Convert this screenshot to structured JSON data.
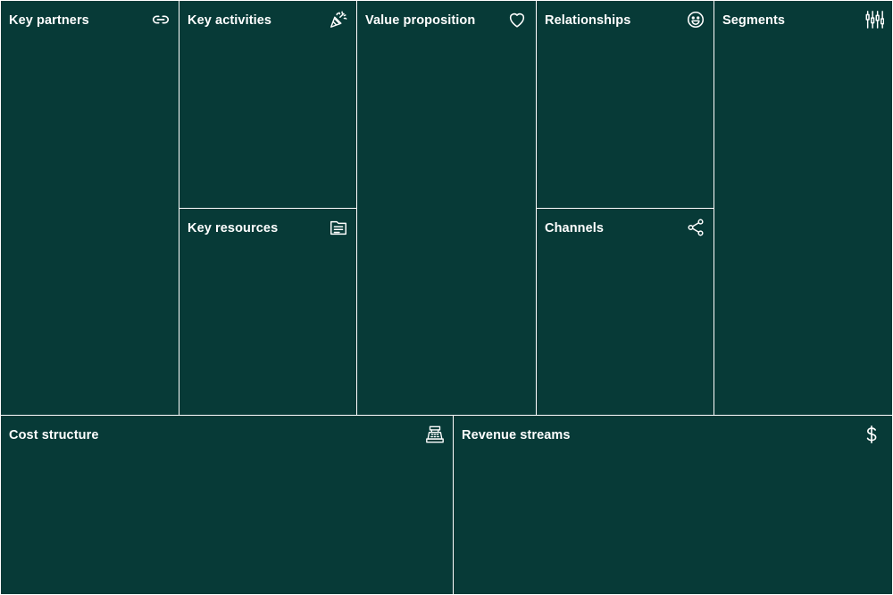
{
  "canvas": {
    "background": "#073a37",
    "line_color": "#ffffff",
    "text_color": "#ffffff"
  },
  "cells": {
    "key_partners": {
      "title": "Key partners",
      "icon": "link-icon"
    },
    "key_activities": {
      "title": "Key activities",
      "icon": "party-popper-icon"
    },
    "key_resources": {
      "title": "Key resources",
      "icon": "document-icon"
    },
    "value_proposition": {
      "title": "Value proposition",
      "icon": "heart-icon"
    },
    "relationships": {
      "title": "Relationships",
      "icon": "smiley-icon"
    },
    "channels": {
      "title": "Channels",
      "icon": "share-icon"
    },
    "segments": {
      "title": "Segments",
      "icon": "sliders-icon"
    },
    "cost_structure": {
      "title": "Cost structure",
      "icon": "cash-register-icon"
    },
    "revenue_streams": {
      "title": "Revenue streams",
      "icon": "dollar-icon"
    }
  }
}
